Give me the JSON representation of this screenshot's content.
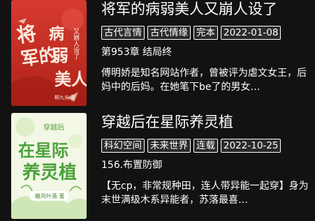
{
  "books": [
    {
      "title": "将军的病弱美人又崩人设了",
      "tags": [
        "古代言情",
        "古代情缘",
        "完本",
        "2022-01-08"
      ],
      "chapter": "第953章 结局终",
      "description": "傅明娇是知名网站作者，曾被评为虐文女王，后妈中的后妈。在她笔下be了的男女…",
      "cover": {
        "main_text": "将军的病弱美人",
        "sub_text": "又崩人设了",
        "author": "柳九长"
      }
    },
    {
      "title": "穿越后在星际养灵植",
      "tags": [
        "科幻空间",
        "未来世界",
        "连载",
        "2022-10-25"
      ],
      "chapter": "156.布置防御",
      "description": "【无cp，非常规种田，连人带异能一起穿】身为末世满级木系异能者，苏落最喜…",
      "cover": {
        "top_text": "穿越后",
        "main_text": "在星际",
        "main_text2": "养灵植",
        "author": "雕风叶落"
      }
    }
  ],
  "colors": {
    "background": "#121212",
    "cover1": "#c8322a",
    "cover2": "#f3f7e6"
  }
}
